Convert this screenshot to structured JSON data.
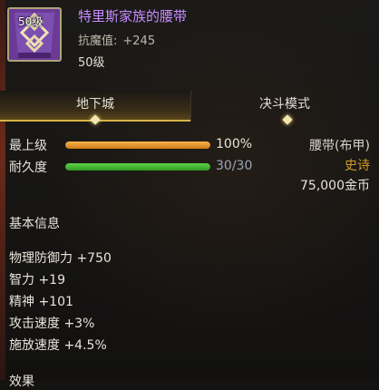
{
  "item": {
    "level_badge": "50级",
    "name": "特里斯家族的腰带",
    "stat_label": "抗魔值:",
    "stat_value": "+245",
    "level": "50级"
  },
  "tabs": [
    {
      "label": "地下城",
      "active": true
    },
    {
      "label": "决斗模式",
      "active": false
    }
  ],
  "bars": [
    {
      "label": "最上级",
      "value_text": "100%",
      "fraction": 1.0,
      "color": "#e89a2c",
      "value_color": "#e8e3d9"
    },
    {
      "label": "耐久度",
      "value_text": "30/30",
      "fraction": 1.0,
      "color": "#3fbf2e",
      "value_color": "#9aa6b8"
    }
  ],
  "right_info": {
    "type": "腰带(布甲)",
    "rarity": "史诗",
    "rarity_color": "#d39a2a",
    "price": "75,000金币"
  },
  "basic_info": {
    "title": "基本信息",
    "stats": [
      "物理防御力 +750",
      "智力 +19",
      "精神 +101",
      "攻击速度 +3%",
      "施放速度 +4.5%"
    ],
    "next_title": "效果"
  },
  "icons": {
    "item_icon": "belt-icon",
    "tab_marker": "diamond-marker-icon"
  }
}
